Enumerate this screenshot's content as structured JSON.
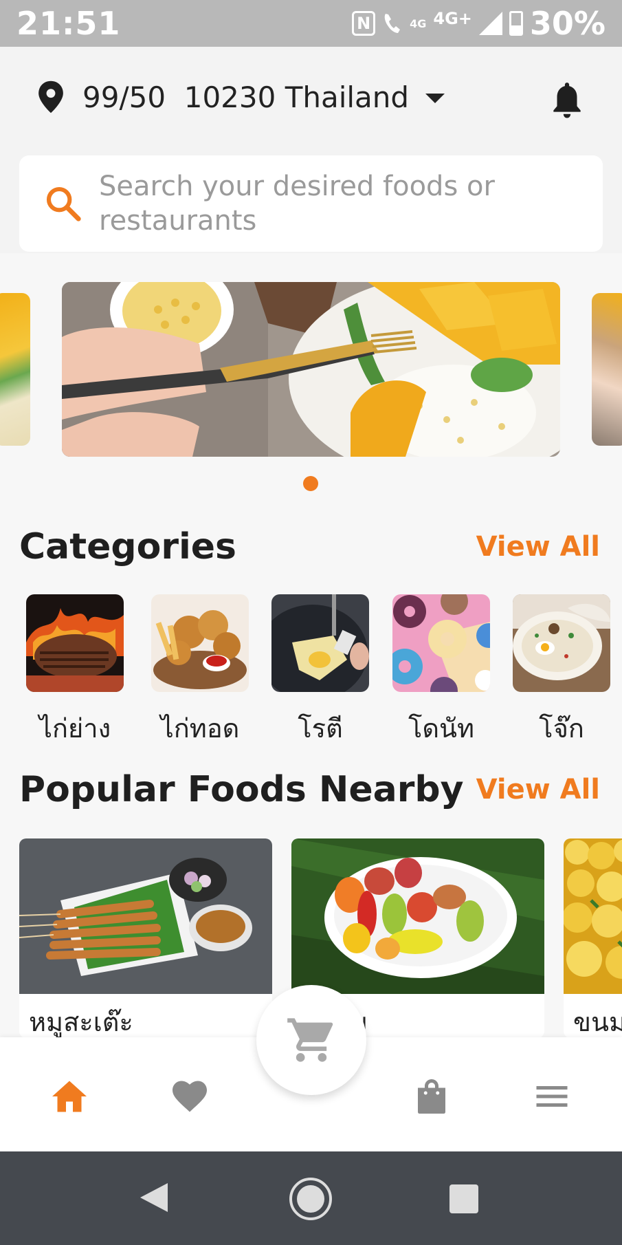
{
  "status_bar": {
    "time": "21:51",
    "nfc": "N",
    "call_network": "4G",
    "network_type": "4G+",
    "battery_percent": "30%"
  },
  "header": {
    "location": "99/50  10230 Thailand",
    "search_placeholder": "Search your desired foods or restaurants"
  },
  "carousel": {
    "active_index": 0,
    "total_dots": 1
  },
  "categories": {
    "title": "Categories",
    "view_all": "View All",
    "items": [
      {
        "label": "ไก่ย่าง"
      },
      {
        "label": "ไก่ทอด"
      },
      {
        "label": "โรตี"
      },
      {
        "label": "โดนัท"
      },
      {
        "label": "โจ๊ก"
      }
    ]
  },
  "popular": {
    "title": "Popular Foods Nearby",
    "view_all": "View All",
    "items": [
      {
        "label": "หมูสะเต๊ะ"
      },
      {
        "label": "ลูกชุบ"
      },
      {
        "label": "ขนม"
      }
    ]
  },
  "bottom_nav": {
    "active": "home"
  },
  "colors": {
    "accent": "#f07b1f",
    "inactive_icon": "#8a8a8a",
    "status_bar": "#b8b8b8",
    "android_nav": "#45494f"
  },
  "icons": [
    "location-pin-icon",
    "caret-down-icon",
    "bell-icon",
    "search-icon",
    "home-icon",
    "heart-icon",
    "cart-icon",
    "bag-icon",
    "menu-icon"
  ]
}
